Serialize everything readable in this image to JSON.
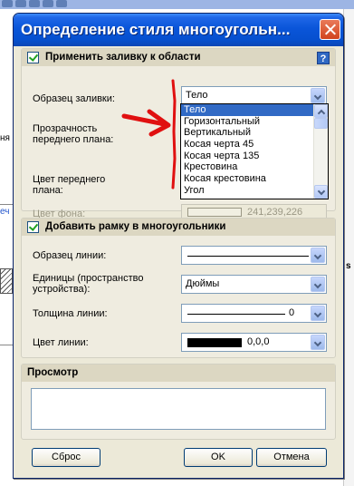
{
  "background": {
    "fragments": {
      "left_1": "ня",
      "left_2": "еч",
      "right_1": "s"
    }
  },
  "window": {
    "title": "Определение стиля многоугольн...",
    "fill_section": {
      "checkbox_label": "Применить заливку к области",
      "help_label": "?",
      "pattern_label": "Образец заливки:",
      "pattern_value": "Тело",
      "transparency_label": "Прозрачность переднего плана:",
      "foreground_label": "Цвет переднего плана:",
      "background_label": "Цвет фона:",
      "background_value": "241,239,226",
      "background_color": "#f1efe2",
      "open_list": {
        "items": [
          "Тело",
          "Горизонтальный",
          "Вертикальный",
          "Косая черта 45",
          "Косая черта 135",
          "Крестовина",
          "Косая крестовина",
          "Угол"
        ],
        "selected": "Тело"
      }
    },
    "border_section": {
      "checkbox_label": "Добавить рамку в многоугольники",
      "line_pattern_label": "Образец линии:",
      "units_label": "Единицы (пространство устройства):",
      "units_value": "Дюймы",
      "width_label": "Толщина линии:",
      "width_value": "0",
      "color_label": "Цвет линии:",
      "color_value": "0,0,0",
      "color_hex": "#000000"
    },
    "preview": {
      "title": "Просмотр"
    },
    "buttons": {
      "reset": "Сброс",
      "ok": "OK",
      "cancel": "Отмена"
    }
  },
  "colors": {
    "title_bar": "#0a55d9",
    "dialog_bg": "#ece9d8",
    "selection": "#316ac5",
    "annotation_arrow": "#e01010"
  }
}
